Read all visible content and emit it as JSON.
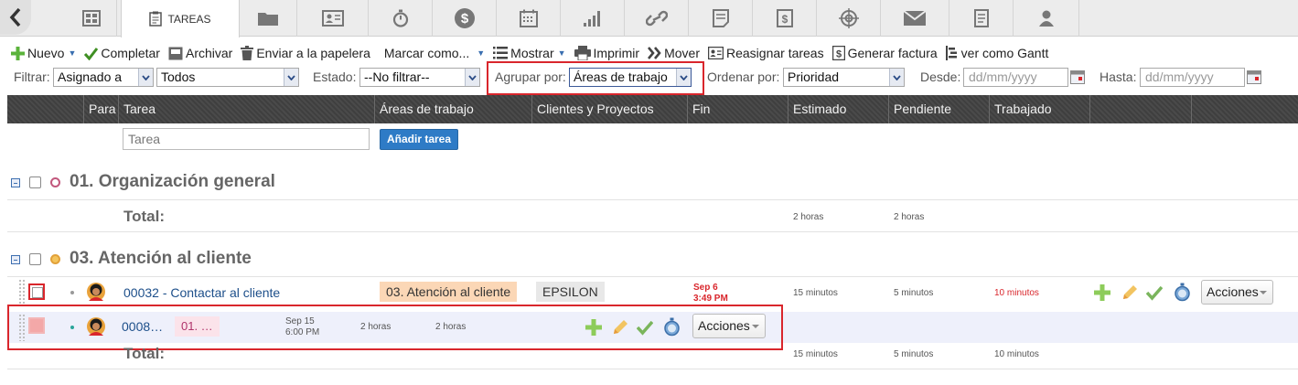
{
  "tabs": {
    "active_label": "TAREAS"
  },
  "toolbar": {
    "nuevo": "Nuevo",
    "completar": "Completar",
    "archivar": "Archivar",
    "papelera": "Enviar a la papelera",
    "marcar": "Marcar como...",
    "mostrar": "Mostrar",
    "imprimir": "Imprimir",
    "mover": "Mover",
    "reasignar": "Reasignar tareas",
    "factura": "Generar factura",
    "gantt": "ver como Gantt"
  },
  "filters": {
    "filtrar_label": "Filtrar:",
    "filtrar_value": "Asignado a",
    "todos_value": "Todos",
    "estado_label": "Estado:",
    "estado_value": "--No filtrar--",
    "agrupar_label": "Agrupar por:",
    "agrupar_value": "Áreas de trabajo",
    "ordenar_label": "Ordenar por:",
    "ordenar_value": "Prioridad",
    "desde_label": "Desde:",
    "desde_placeholder": "dd/mm/yyyy",
    "hasta_label": "Hasta:",
    "hasta_placeholder": "dd/mm/yyyy"
  },
  "columns": [
    "Para",
    "Tarea",
    "Áreas de trabajo",
    "Clientes y Proyectos",
    "Fin",
    "Estimado",
    "Pendiente",
    "Trabajado"
  ],
  "add_task": {
    "placeholder": "Tarea",
    "button": "Añadir tarea"
  },
  "groups": [
    {
      "title": "01. Organización general",
      "total_label": "Total:",
      "estimado": "2 horas",
      "pendiente": "2 horas"
    },
    {
      "title": "03. Atención al cliente",
      "total_label": "Total:",
      "estimado": "15 minutos",
      "pendiente": "5 minutos",
      "trabajado": "10 minutos",
      "tasks": [
        {
          "name": "00032 - Contactar al cliente",
          "area": "03. Atención al cliente",
          "client": "EPSILON",
          "due_date": "Sep 6",
          "due_time": "3:49 PM",
          "estimado": "15 minutos",
          "pendiente": "5 minutos",
          "trabajado": "10 minutos",
          "actions": "Acciones"
        },
        {
          "name": "0008…",
          "area": "01. …",
          "due_date": "Sep 15",
          "due_time": "6:00 PM",
          "estimado": "2 horas",
          "pendiente": "2 horas",
          "actions": "Acciones"
        }
      ]
    }
  ],
  "colors": {
    "accent": "#2e7bc6",
    "highlight": "#d9262c",
    "header": "#444444",
    "area_badge": "#fbd7b6"
  }
}
